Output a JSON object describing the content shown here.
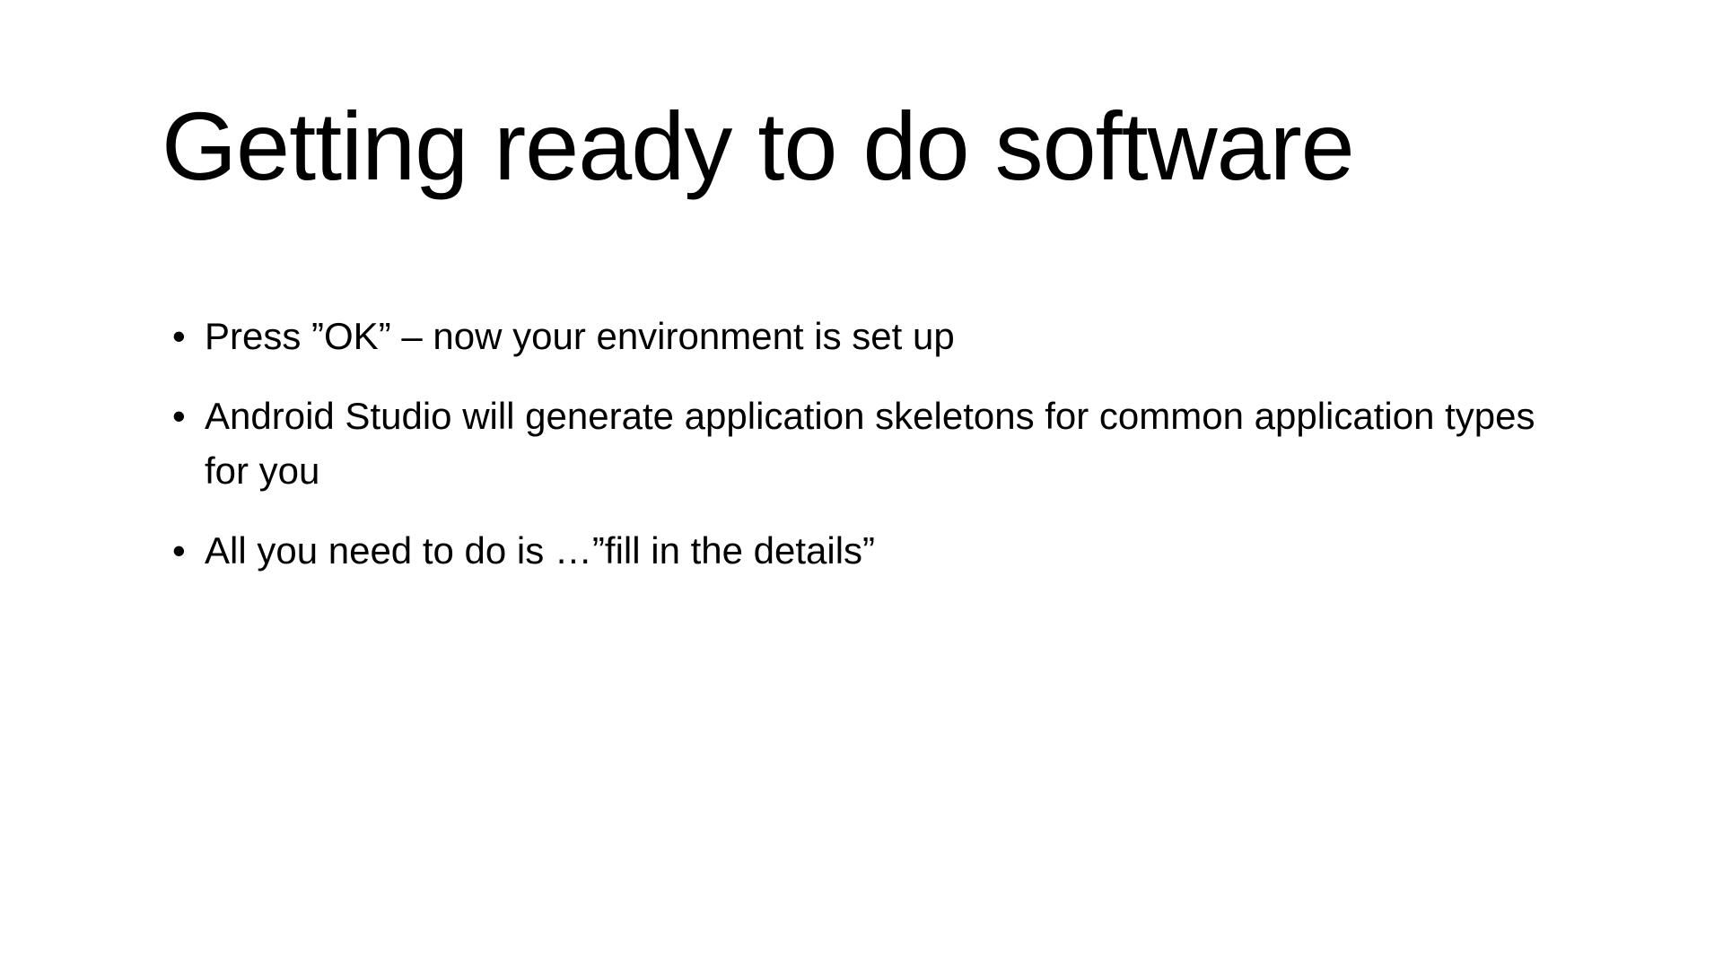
{
  "slide": {
    "title": "Getting ready to do software",
    "bullets": [
      "Press ”OK” – now your environment is set up",
      "Android Studio will generate application skeletons for common application types for you",
      "All you need to do is …”fill in the details”"
    ]
  }
}
